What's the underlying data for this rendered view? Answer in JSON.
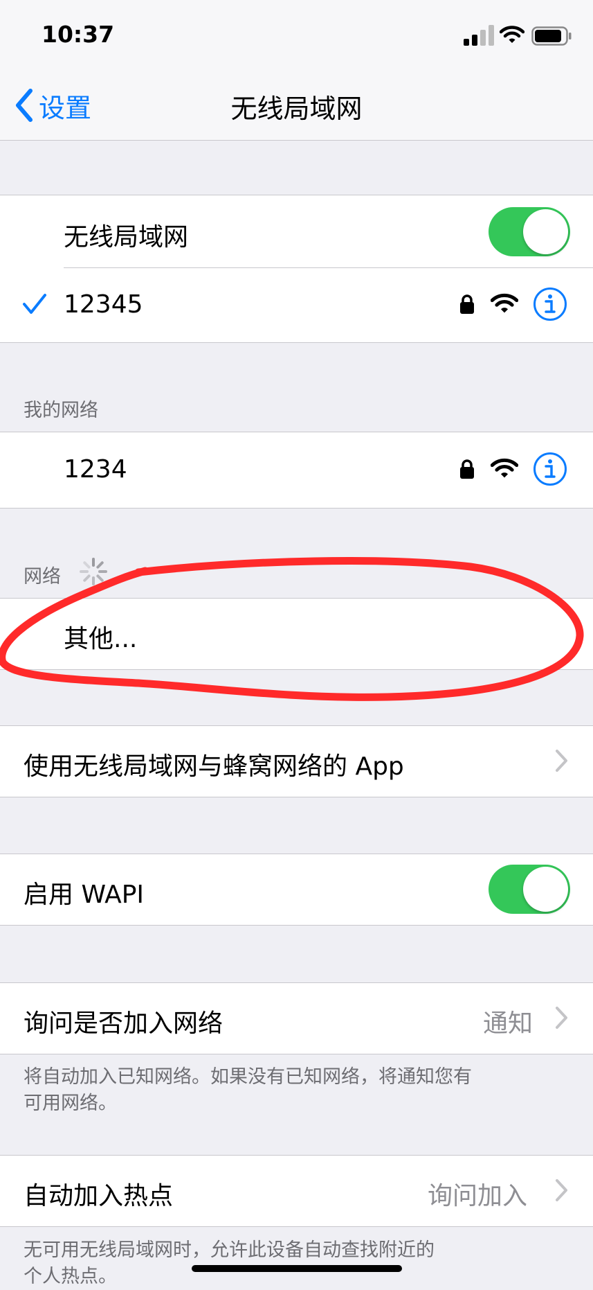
{
  "status": {
    "time": "10:37"
  },
  "nav": {
    "back_label": "设置",
    "title": "无线局域网"
  },
  "wifi": {
    "label": "无线局域网",
    "enabled": true
  },
  "connected": {
    "name": "12345"
  },
  "my_networks": {
    "header": "我的网络",
    "items": [
      {
        "name": "1234"
      }
    ]
  },
  "networks": {
    "header": "网络",
    "other_label": "其他..."
  },
  "apps": {
    "label": "使用无线局域网与蜂窝网络的 App"
  },
  "wapi": {
    "label": "启用 WAPI",
    "enabled": true
  },
  "ask_join": {
    "label": "询问是否加入网络",
    "value": "通知",
    "note_line1": "将自动加入已知网络。如果没有已知网络，将通知您有",
    "note_line2": "可用网络。"
  },
  "hotspot": {
    "label": "自动加入热点",
    "value": "询问加入",
    "note_line1": "无可用无线局域网时，允许此设备自动查找附近的",
    "note_line2": "个人热点。"
  },
  "annotation": {
    "color": "#ff2a2a"
  }
}
